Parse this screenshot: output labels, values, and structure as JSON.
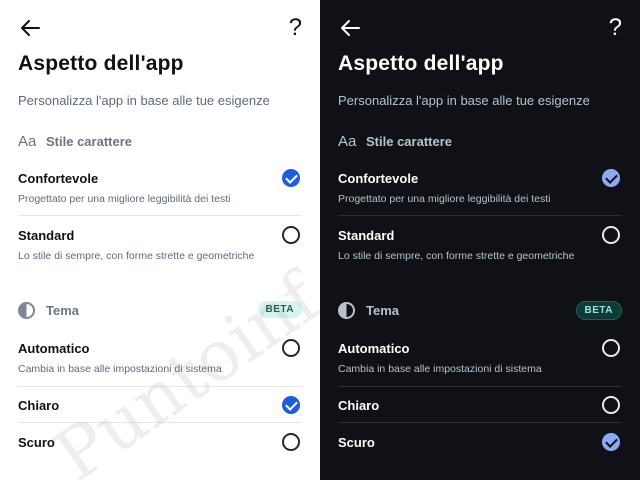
{
  "panels": [
    {
      "theme": "light",
      "help_symbol": "?",
      "title": "Aspetto dell'app",
      "subtitle": "Personalizza l'app in base alle tue esigenze",
      "font_section": {
        "icon_text": "Aa",
        "label": "Stile carattere"
      },
      "font_options": [
        {
          "label": "Confortevole",
          "description": "Progettato per una migliore leggibilità dei testi",
          "selected": true
        },
        {
          "label": "Standard",
          "description": "Lo stile di sempre, con forme strette e geometriche",
          "selected": false
        }
      ],
      "theme_section": {
        "label": "Tema",
        "badge": "BETA"
      },
      "theme_options": [
        {
          "label": "Automatico",
          "description": "Cambia in base alle impostazioni di sistema",
          "selected": false
        },
        {
          "label": "Chiaro",
          "description": "",
          "selected": true
        },
        {
          "label": "Scuro",
          "description": "",
          "selected": false
        }
      ]
    },
    {
      "theme": "dark",
      "help_symbol": "?",
      "title": "Aspetto dell'app",
      "subtitle": "Personalizza l'app in base alle tue esigenze",
      "font_section": {
        "icon_text": "Aa",
        "label": "Stile carattere"
      },
      "font_options": [
        {
          "label": "Confortevole",
          "description": "Progettato per una migliore leggibilità dei testi",
          "selected": true
        },
        {
          "label": "Standard",
          "description": "Lo stile di sempre, con forme strette e geometriche",
          "selected": false
        }
      ],
      "theme_section": {
        "label": "Tema",
        "badge": "BETA"
      },
      "theme_options": [
        {
          "label": "Automatico",
          "description": "Cambia in base alle impostazioni di sistema",
          "selected": false
        },
        {
          "label": "Chiaro",
          "description": "",
          "selected": false
        },
        {
          "label": "Scuro",
          "description": "",
          "selected": true
        }
      ]
    }
  ],
  "colors": {
    "light_bg": "#ffffff",
    "dark_bg": "#0f1116",
    "light_accent": "#1e5ddc",
    "dark_accent": "#8ea9f3",
    "beta_badge_light": "#d8f3ef",
    "beta_badge_dark": "#0e3b37"
  },
  "icons": {
    "back": "arrow-left-icon",
    "help": "question-mark-icon",
    "font_style": "font-style-icon",
    "theme": "half-circle-contrast-icon",
    "radio_selected": "check-circle-icon",
    "radio_unselected": "empty-circle-icon"
  },
  "watermark": "Puntoinf"
}
